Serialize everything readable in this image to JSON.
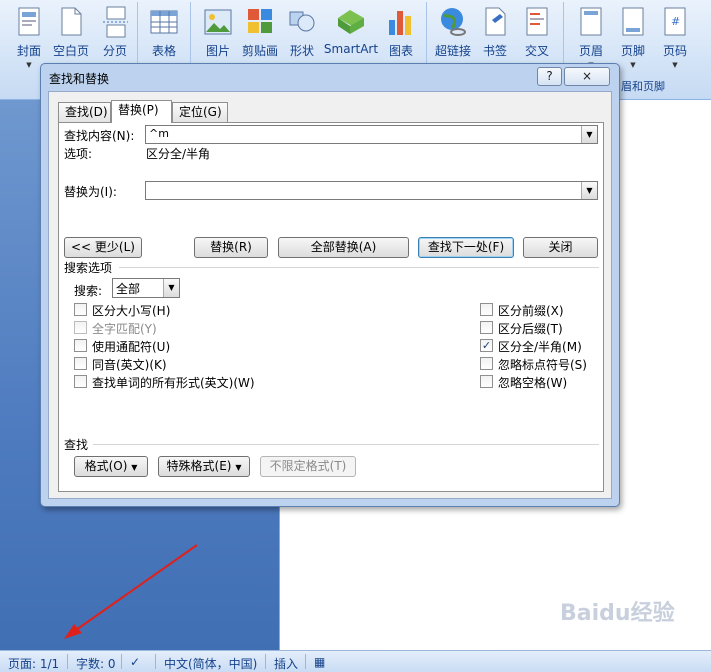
{
  "ribbon": {
    "buttons": [
      {
        "label": "封面",
        "icon": "cover-page-icon"
      },
      {
        "label": "空白页",
        "icon": "blank-page-icon"
      },
      {
        "label": "分页",
        "icon": "page-break-icon"
      },
      {
        "label": "表格",
        "icon": "table-icon"
      },
      {
        "label": "图片",
        "icon": "picture-icon"
      },
      {
        "label": "剪贴画",
        "icon": "clip-art-icon"
      },
      {
        "label": "形状",
        "icon": "shapes-icon"
      },
      {
        "label": "SmartArt",
        "icon": "smartart-icon"
      },
      {
        "label": "图表",
        "icon": "chart-icon"
      },
      {
        "label": "超链接",
        "icon": "hyperlink-icon"
      },
      {
        "label": "书签",
        "icon": "bookmark-icon"
      },
      {
        "label": "交叉",
        "icon": "cross-reference-icon"
      },
      {
        "label": "页眉",
        "icon": "header-icon"
      },
      {
        "label": "页脚",
        "icon": "footer-icon"
      },
      {
        "label": "页码",
        "icon": "page-number-icon"
      }
    ],
    "group_header_footer_label": "眉和页脚"
  },
  "dialog": {
    "title": "查找和替换",
    "help_button": "?",
    "close_button": "×",
    "tabs": [
      {
        "label": "查找(D)",
        "active": false
      },
      {
        "label": "替换(P)",
        "active": true
      },
      {
        "label": "定位(G)",
        "active": false
      }
    ],
    "find_label": "查找内容(N):",
    "find_value": "^m",
    "options_label": "选项:",
    "options_value": "区分全/半角",
    "replace_label": "替换为(I):",
    "replace_value": "",
    "buttons": {
      "less": "<< 更少(L)",
      "replace": "替换(R)",
      "replace_all": "全部替换(A)",
      "find_next": "查找下一处(F)",
      "close": "关闭"
    },
    "search_options_title": "搜索选项",
    "search_label": "搜索:",
    "search_value": "全部",
    "left_options": [
      {
        "label": "区分大小写(H)",
        "checked": false,
        "disabled": false
      },
      {
        "label": "全字匹配(Y)",
        "checked": false,
        "disabled": true
      },
      {
        "label": "使用通配符(U)",
        "checked": false,
        "disabled": false
      },
      {
        "label": "同音(英文)(K)",
        "checked": false,
        "disabled": false
      },
      {
        "label": "查找单词的所有形式(英文)(W)",
        "checked": false,
        "disabled": false
      }
    ],
    "right_options": [
      {
        "label": "区分前缀(X)",
        "checked": false,
        "disabled": false
      },
      {
        "label": "区分后缀(T)",
        "checked": false,
        "disabled": false
      },
      {
        "label": "区分全/半角(M)",
        "checked": true,
        "disabled": false
      },
      {
        "label": "忽略标点符号(S)",
        "checked": false,
        "disabled": false
      },
      {
        "label": "忽略空格(W)",
        "checked": false,
        "disabled": false
      }
    ],
    "find_section_title": "查找",
    "format_button": "格式(O)",
    "special_button": "特殊格式(E)",
    "no_format_button": "不限定格式(T)"
  },
  "statusbar": {
    "page": "页面: 1/1",
    "words": "字数: 0",
    "language": "中文(简体，中国)",
    "mode": "插入"
  },
  "watermark": "Baidu经验"
}
